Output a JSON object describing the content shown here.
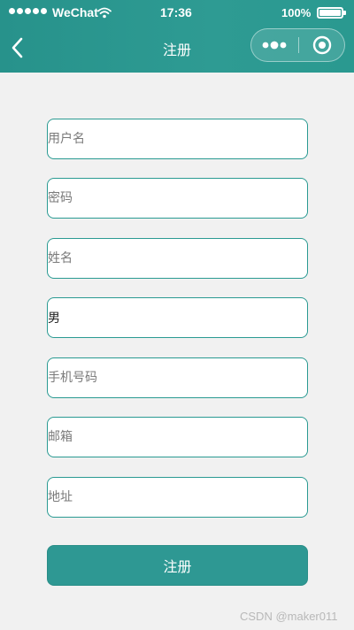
{
  "status_bar": {
    "carrier": "WeChat",
    "time": "17:36",
    "battery_percent_label": "100%",
    "battery_level": 1.0,
    "icons": [
      "signal-dots-icon",
      "wifi-icon",
      "battery-icon"
    ]
  },
  "nav": {
    "title": "注册",
    "back_icon": "chevron-left-icon",
    "capsule_icons": [
      "more-dots-icon",
      "close-circle-icon"
    ]
  },
  "form": {
    "username_placeholder": "用户名",
    "password_placeholder": "密码",
    "name_placeholder": "姓名",
    "gender_value": "男",
    "phone_placeholder": "手机号码",
    "email_placeholder": "邮箱",
    "address_placeholder": "地址",
    "submit_label": "注册"
  },
  "watermark": "CSDN @maker011",
  "colors": {
    "header": "#2e9b93",
    "accent": "#2a9a92",
    "button": "#2e9893",
    "background": "#f1f1f1"
  }
}
